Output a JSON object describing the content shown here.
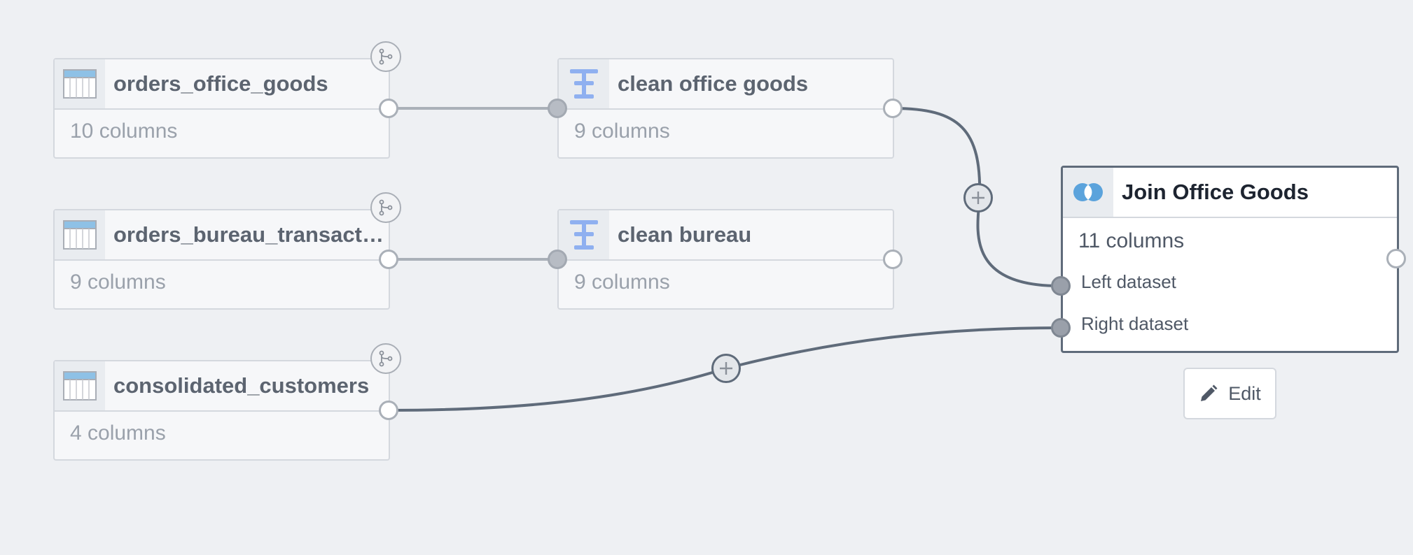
{
  "nodes": {
    "orders_office_goods": {
      "title": "orders_office_goods",
      "sub": "10 columns"
    },
    "orders_bureau": {
      "title": "orders_bureau_transacti…",
      "sub": "9 columns"
    },
    "consolidated_customers": {
      "title": "consolidated_customers",
      "sub": "4 columns"
    },
    "clean_office_goods": {
      "title": "clean office goods",
      "sub": "9 columns"
    },
    "clean_bureau": {
      "title": "clean bureau",
      "sub": "9 columns"
    },
    "join_office_goods": {
      "title": "Join Office Goods",
      "sub": "11 columns",
      "left_port": "Left dataset",
      "right_port": "Right dataset"
    }
  },
  "edit_button": {
    "label": "Edit"
  },
  "colors": {
    "canvas_bg": "#eef0f3",
    "node_border": "#d4d8de",
    "selected_border": "#5f6b7a",
    "dataset_icon_blue": "#8ec1e6",
    "transform_icon_blue": "#8fb0f0",
    "join_icon_blue": "#5ba3dc",
    "edge_light": "#aab0b8",
    "edge_dark": "#5f6b7a"
  },
  "icons": {
    "dataset": "table-icon",
    "transform": "transform-icon",
    "join": "join-icon",
    "branch": "branch-icon",
    "add": "plus-icon",
    "edit": "pencil-icon"
  }
}
